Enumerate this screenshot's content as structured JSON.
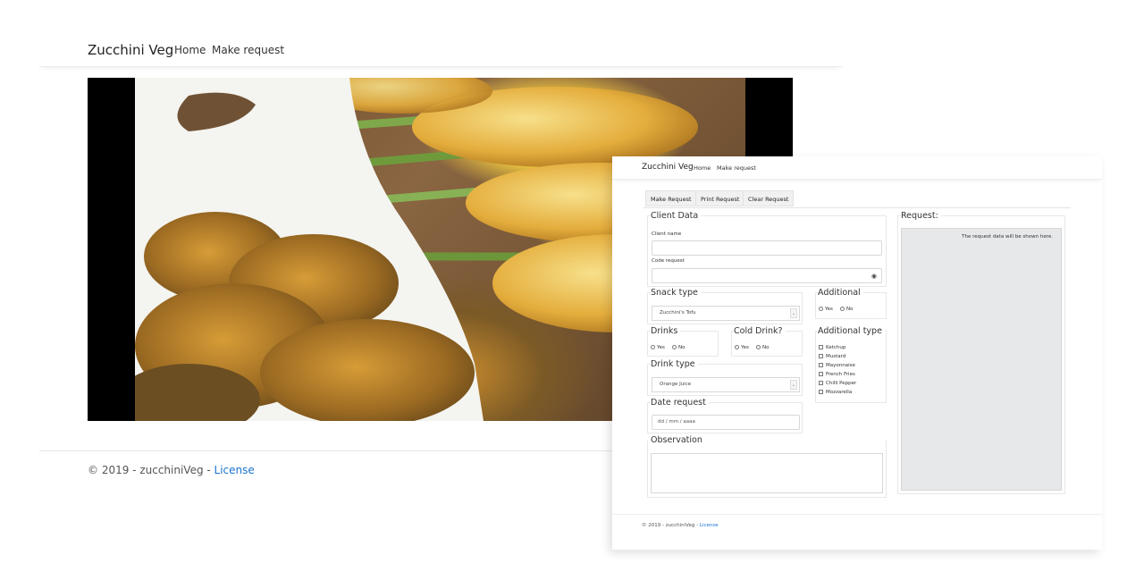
{
  "back": {
    "brand": "Zucchini Veg",
    "nav": {
      "home": "Home",
      "make_request": "Make request"
    },
    "footer": {
      "copyright": "© 2019 - zucchiniVeg - ",
      "license": "License"
    }
  },
  "front": {
    "brand": "Zucchini Veg",
    "nav": {
      "home": "Home",
      "make_request": "Make request"
    },
    "buttons": {
      "make": "Make Request",
      "print": "Print Request",
      "clear": "Clear Request"
    },
    "client_data": {
      "legend": "Client Data",
      "client_name_label": "Client name",
      "code_request_label": "Code request"
    },
    "snack": {
      "legend": "Snack type",
      "selected": "Zucchini's Tofu"
    },
    "additional": {
      "legend": "Additional",
      "yes": "Yes",
      "no": "No"
    },
    "drinks": {
      "legend": "Drinks",
      "yes": "Yes",
      "no": "No"
    },
    "cold_drink": {
      "legend": "Cold Drink?",
      "yes": "Yes",
      "no": "No"
    },
    "additional_type": {
      "legend": "Additional type",
      "items": [
        "Ketchup",
        "Mustard",
        "Mayonnaise",
        "French Fries",
        "Chilli Pepper",
        "Mozzarella"
      ]
    },
    "drink_type": {
      "legend": "Drink type",
      "selected": "Orange Juice"
    },
    "date_request": {
      "legend": "Date request",
      "placeholder": "dd / mm / aaaa"
    },
    "observation": {
      "legend": "Observation"
    },
    "request": {
      "legend": "Request:",
      "placeholder_text": "The request data will be shown here."
    },
    "footer": {
      "copyright": "© 2019 - zucchiniVeg - ",
      "license": "License"
    }
  }
}
